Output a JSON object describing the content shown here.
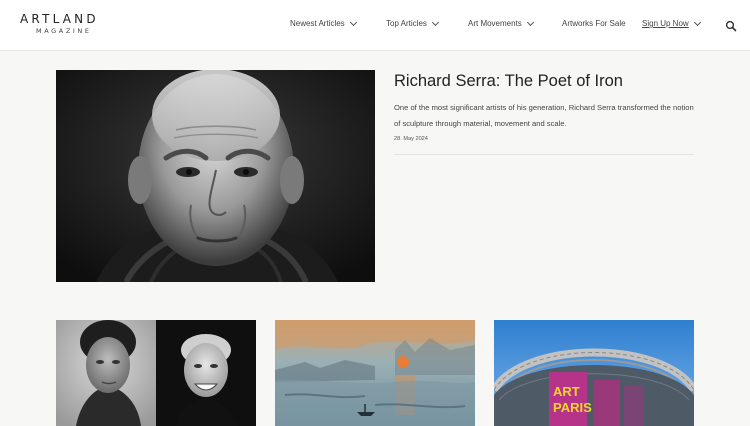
{
  "logo": {
    "main": "ARTLAND",
    "sub": "MAGAZINE"
  },
  "nav": {
    "items": [
      {
        "label": "Newest Articles"
      },
      {
        "label": "Top Articles"
      },
      {
        "label": "Art Movements"
      },
      {
        "label": "Artworks For Sale"
      },
      {
        "label": "Sign Up Now"
      }
    ],
    "search_icon": "search-icon"
  },
  "hero": {
    "title": "Richard Serra: The Poet of Iron",
    "description": "One of the most significant artists of his generation, Richard Serra transformed the notion of sculpture through material, movement and scale.",
    "date": "28. May 2024"
  },
  "cards": {
    "art_paris_sign": {
      "line1": "ART",
      "line2": "PARIS"
    }
  }
}
